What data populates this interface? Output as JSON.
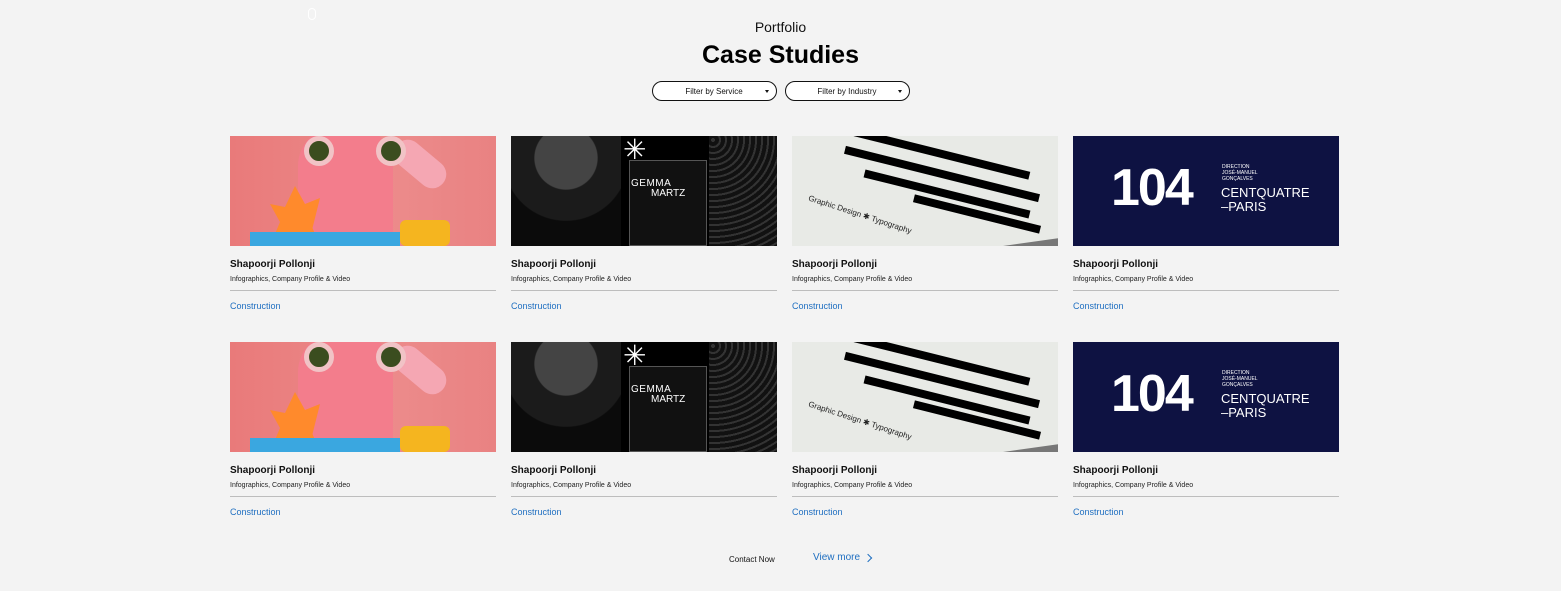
{
  "header": {
    "eyebrow": "Portfolio",
    "title": "Case Studies"
  },
  "filters": {
    "service": "Filter by Service",
    "industry": "Filter by Industry"
  },
  "thumbnails": {
    "gemma_line1": "GEMMA",
    "gemma_line2": "MARTZ",
    "book_text": "Graphic Design ✱ Typography",
    "centquatre_logo": "104",
    "centquatre_direction": "DIRECTION\nJOSÉ-MANUEL\nGONÇALVES",
    "centquatre_name": "CENTQUATRE\n–PARIS"
  },
  "cards": [
    {
      "title": "Shapoorji Pollonji",
      "services": "Infographics, Company Profile & Video",
      "industry": "Construction"
    },
    {
      "title": "Shapoorji Pollonji",
      "services": "Infographics, Company Profile & Video",
      "industry": "Construction"
    },
    {
      "title": "Shapoorji Pollonji",
      "services": "Infographics, Company Profile & Video",
      "industry": "Construction"
    },
    {
      "title": "Shapoorji Pollonji",
      "services": "Infographics, Company Profile & Video",
      "industry": "Construction"
    },
    {
      "title": "Shapoorji Pollonji",
      "services": "Infographics, Company Profile & Video",
      "industry": "Construction"
    },
    {
      "title": "Shapoorji Pollonji",
      "services": "Infographics, Company Profile & Video",
      "industry": "Construction"
    },
    {
      "title": "Shapoorji Pollonji",
      "services": "Infographics, Company Profile & Video",
      "industry": "Construction"
    },
    {
      "title": "Shapoorji Pollonji",
      "services": "Infographics, Company Profile & Video",
      "industry": "Construction"
    }
  ],
  "footer": {
    "contact": "Contact Now",
    "view_more": "View more"
  },
  "colors": {
    "background": "#f3f3f3",
    "link": "#1f6fc1",
    "text": "#111111"
  }
}
